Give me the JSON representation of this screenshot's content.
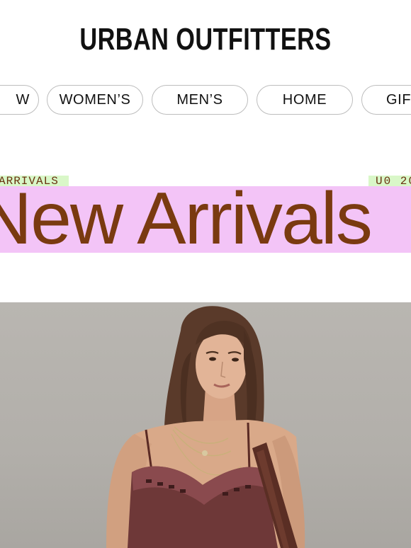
{
  "brand": {
    "logo_text": "URBAN OUTFITTERS"
  },
  "nav": {
    "items": [
      {
        "label": "W"
      },
      {
        "label": "WOMEN’S"
      },
      {
        "label": "MEN’S"
      },
      {
        "label": "HOME"
      },
      {
        "label": "GIF"
      }
    ]
  },
  "promo": {
    "tag_left": "ARRIVALS",
    "tag_right": "U0 20",
    "headline": "New Arrivals",
    "colors": {
      "band": "#f3c4f7",
      "headline": "#7a3a10",
      "tag_bg": "#d9f7c8"
    }
  },
  "hero": {
    "image_icon": "model-photo"
  }
}
